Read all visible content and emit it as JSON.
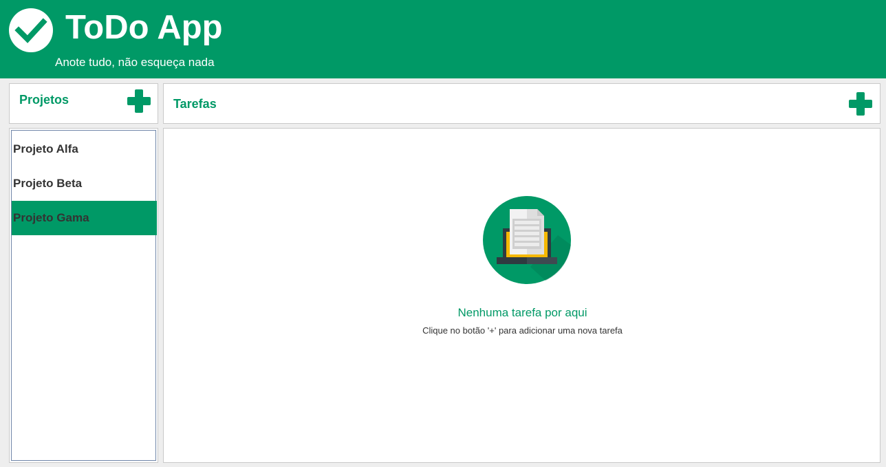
{
  "header": {
    "title": "ToDo App",
    "subtitle": "Anote tudo, não esqueça nada",
    "logo_icon": "check-circle-icon",
    "background_color": "#009966"
  },
  "projects": {
    "title": "Projetos",
    "add_icon": "plus-icon",
    "items": [
      {
        "label": "Projeto Alfa",
        "selected": false
      },
      {
        "label": "Projeto Beta",
        "selected": false
      },
      {
        "label": "Projeto Gama",
        "selected": true
      }
    ]
  },
  "tasks": {
    "title": "Tarefas",
    "add_icon": "plus-icon",
    "empty_state": {
      "icon": "laptop-document-icon",
      "title": "Nenhuma tarefa por aqui",
      "hint": "Clique no botão '+' para adicionar uma nova tarefa"
    }
  },
  "colors": {
    "accent": "#009966",
    "text": "#333333",
    "panel_border": "#c9c9c9",
    "background": "#eeeeee"
  }
}
